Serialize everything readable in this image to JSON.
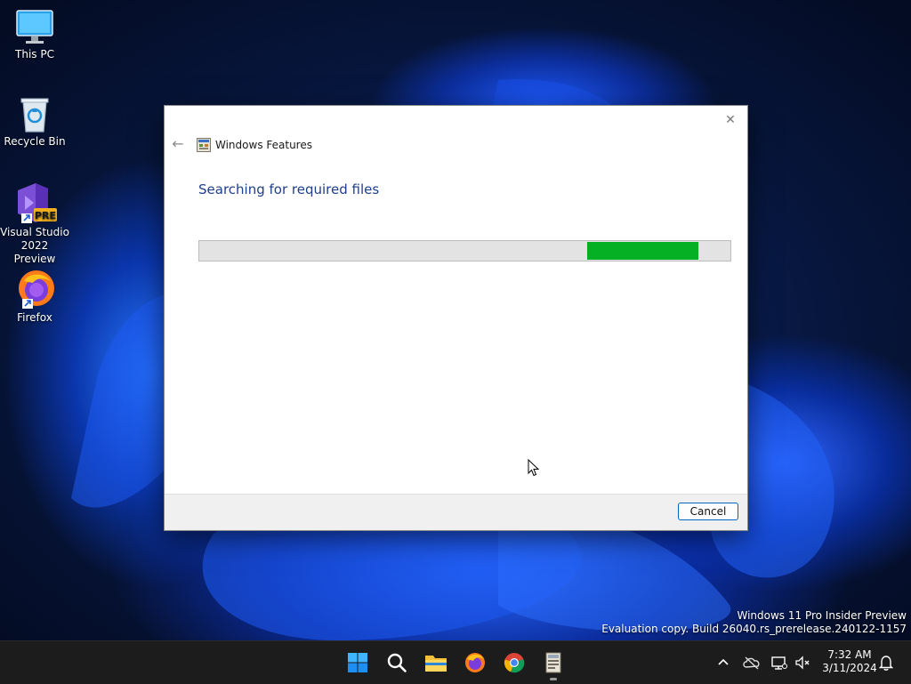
{
  "desktop": {
    "icons": [
      {
        "label": "This PC"
      },
      {
        "label": "Recycle Bin"
      },
      {
        "label_line1": "Visual Studio",
        "label_line2": "2022 Preview",
        "badge": "PRE"
      },
      {
        "label": "Firefox"
      }
    ]
  },
  "dialog": {
    "title": "Windows Features",
    "heading": "Searching for required files",
    "progress": {
      "fill_start": 0.73,
      "fill_end": 0.94
    },
    "cancel_label": "Cancel",
    "accent_color": "#06b025"
  },
  "watermark": {
    "line1": "Windows 11 Pro Insider Preview",
    "line2": "Evaluation copy. Build 26040.rs_prerelease.240122-1157"
  },
  "taskbar": {
    "apps": [
      "windows-start-icon",
      "search-icon",
      "file-explorer-icon",
      "firefox-icon",
      "chrome-icon",
      "windows-features-icon"
    ],
    "clock": {
      "time": "7:32 AM",
      "date": "3/11/2024"
    }
  }
}
